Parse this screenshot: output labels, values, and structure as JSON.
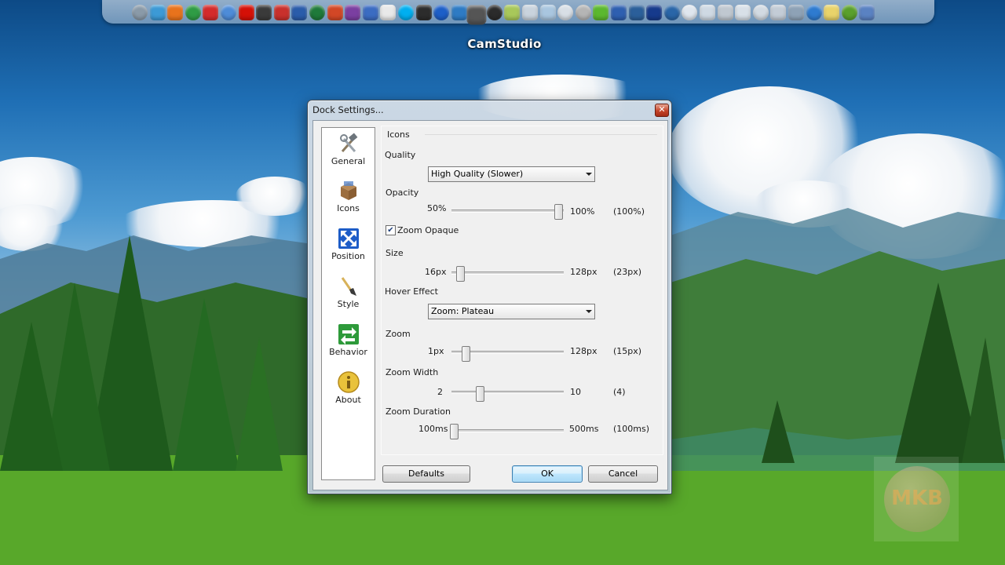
{
  "dock": {
    "hover_label": "CamStudio",
    "icons": [
      {
        "name": "disk-utility-icon",
        "color": "#8a9aa8"
      },
      {
        "name": "safari-icon",
        "color": "#3c9ad6"
      },
      {
        "name": "firefox-icon",
        "color": "#e8731c"
      },
      {
        "name": "chrome-icon",
        "color": "#2f9c45"
      },
      {
        "name": "opera-icon",
        "color": "#d42b2b"
      },
      {
        "name": "itunes-icon",
        "color": "#4e8cd8"
      },
      {
        "name": "lastfm-icon",
        "color": "#d51007"
      },
      {
        "name": "film-reel-icon",
        "color": "#3a3a3a"
      },
      {
        "name": "download-icon",
        "color": "#c9302c"
      },
      {
        "name": "word-icon",
        "color": "#2a5caa"
      },
      {
        "name": "excel-icon",
        "color": "#1f7a3a"
      },
      {
        "name": "powerpoint-icon",
        "color": "#d24726"
      },
      {
        "name": "onenote-icon",
        "color": "#7b3fa1"
      },
      {
        "name": "visio-icon",
        "color": "#3b6cc2"
      },
      {
        "name": "windows-live-icon",
        "color": "#e9e9e9"
      },
      {
        "name": "skype-icon",
        "color": "#00aff0"
      },
      {
        "name": "camera-icon",
        "color": "#2c2c2c"
      },
      {
        "name": "bluetooth-icon",
        "color": "#1d5fc8"
      },
      {
        "name": "google-earth-icon",
        "color": "#2e7bc4"
      },
      {
        "name": "camstudio-icon",
        "color": "#555555",
        "hovered": true
      },
      {
        "name": "vlc-icon",
        "color": "#2b2b2b"
      },
      {
        "name": "notepad-icon",
        "color": "#a8c85a"
      },
      {
        "name": "documents-icon",
        "color": "#c9d3dd"
      },
      {
        "name": "folder-icon",
        "color": "#a9c6df"
      },
      {
        "name": "scanner-icon",
        "color": "#d8dfe6"
      },
      {
        "name": "archive-icon",
        "color": "#b5b5b5"
      },
      {
        "name": "xbox-icon",
        "color": "#5bb82f"
      },
      {
        "name": "media-player-icon",
        "color": "#2e5fb0"
      },
      {
        "name": "media-center-icon",
        "color": "#2b5f9a"
      },
      {
        "name": "globe-icon",
        "color": "#163a8c"
      },
      {
        "name": "game-controller-icon",
        "color": "#2a66a8"
      },
      {
        "name": "computer-icon",
        "color": "#dfe6ee"
      },
      {
        "name": "network-icon",
        "color": "#cfd9e3"
      },
      {
        "name": "drive-icon",
        "color": "#c0c8d0"
      },
      {
        "name": "recycle-icon",
        "color": "#d8e0e8"
      },
      {
        "name": "control-panel-icon",
        "color": "#d2dae2"
      },
      {
        "name": "settings-icon",
        "color": "#c3ccd6"
      },
      {
        "name": "tools-icon",
        "color": "#8ea2b6"
      },
      {
        "name": "usb-icon",
        "color": "#2e7bd0"
      },
      {
        "name": "tree-icon",
        "color": "#e9d36a"
      },
      {
        "name": "utorrent-icon",
        "color": "#5aa02c"
      },
      {
        "name": "mail-icon",
        "color": "#5a82c2"
      }
    ]
  },
  "dialog": {
    "title": "Dock Settings...",
    "nav": [
      {
        "label": "General",
        "icon": "tools-icon"
      },
      {
        "label": "Icons",
        "icon": "box-icon"
      },
      {
        "label": "Position",
        "icon": "position-arrows-icon"
      },
      {
        "label": "Style",
        "icon": "paintbrush-icon"
      },
      {
        "label": "Behavior",
        "icon": "behavior-arrows-icon"
      },
      {
        "label": "About",
        "icon": "info-icon"
      }
    ],
    "section_title": "Icons",
    "quality": {
      "label": "Quality",
      "selected": "High Quality (Slower)"
    },
    "opacity": {
      "label": "Opacity",
      "min": "50%",
      "max": "100%",
      "current": "(100%)",
      "fraction": 1.0
    },
    "zoom_opaque": {
      "label": "Zoom Opaque",
      "checked": true
    },
    "size": {
      "label": "Size",
      "min": "16px",
      "max": "128px",
      "current": "(23px)",
      "fraction": 0.06
    },
    "hover_effect": {
      "label": "Hover Effect",
      "selected": "Zoom: Plateau"
    },
    "zoom": {
      "label": "Zoom",
      "min": "1px",
      "max": "128px",
      "current": "(15px)",
      "fraction": 0.11
    },
    "zoom_width": {
      "label": "Zoom Width",
      "min": "2",
      "max": "10",
      "current": "(4)",
      "fraction": 0.25
    },
    "zoom_duration": {
      "label": "Zoom Duration",
      "min": "100ms",
      "max": "500ms",
      "current": "(100ms)",
      "fraction": 0.0
    },
    "buttons": {
      "defaults": "Defaults",
      "ok": "OK",
      "cancel": "Cancel"
    }
  },
  "watermark": {
    "text": "MKB"
  }
}
